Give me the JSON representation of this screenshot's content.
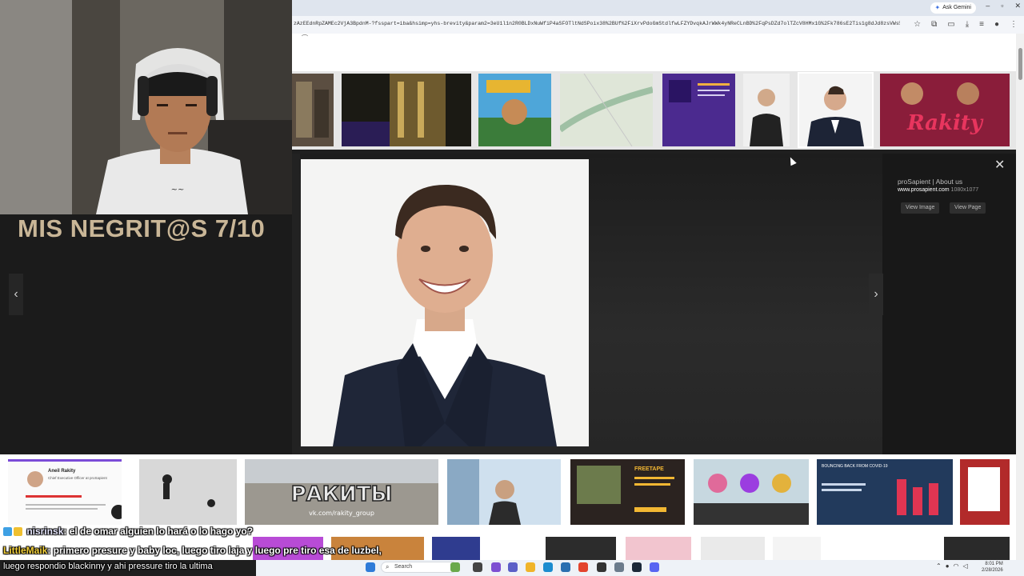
{
  "browser": {
    "gemini_label": "Ask Gemini",
    "url": "zAzEEdnRpZAMEc2VjA3BpdnM-?fsspart=iba&hsimp=yhs-brevity&param2=3eU1l1n2R0BLDxNuWfiP4aSFOTltNdSPoix38%2BUf%2FiXrvPdoGmStdlfwLFZYDvqkAJrWWk4yNReCLnBD%2FqPsDZd7olTZcV8HMx1G%2Fk786sE2Tis1g8dJd8zsVWs%2BbK..."
  },
  "overlay": {
    "title": "MIS NEGRIT@S 7/10"
  },
  "viewer": {
    "source": "proSapient | About us",
    "domain": "www.prosapient.com",
    "dimensions": "1080x1077",
    "view_image_label": "View Image",
    "view_page_label": "View Page"
  },
  "bottom_results": {
    "card1_name": "Aneil Rakity",
    "card1_role": "Chief Executive Officer at proSapient",
    "card3_text": "РАКИТЫ",
    "card3_sub": "vk.com/rakity_group",
    "card6_text": "BOUNCING BACK FROM COVID-19",
    "card5_text": "FREETAPE"
  },
  "top_strip": {
    "rakity_label": "Rakity"
  },
  "chat": {
    "line1_user": "nisrinsk",
    "line1_msg": ": el de omar alguien lo hará o lo hago yo?",
    "line2_user": "LittleMaik",
    "line2_msg": ": primero presure y baby loc, luego tiro laja y luego pre tiro esa de luzbel,",
    "line3_msg": "luego respondio blackinny y ahi pressure tiro la ultima"
  },
  "taskbar": {
    "search_placeholder": "Search",
    "time": "8:01 PM",
    "date": "2/28/2026"
  },
  "colors": {
    "overlay_title": "#c9b697",
    "viewer_bg": "#222222",
    "accent_gemini": "#3b6fe0"
  }
}
